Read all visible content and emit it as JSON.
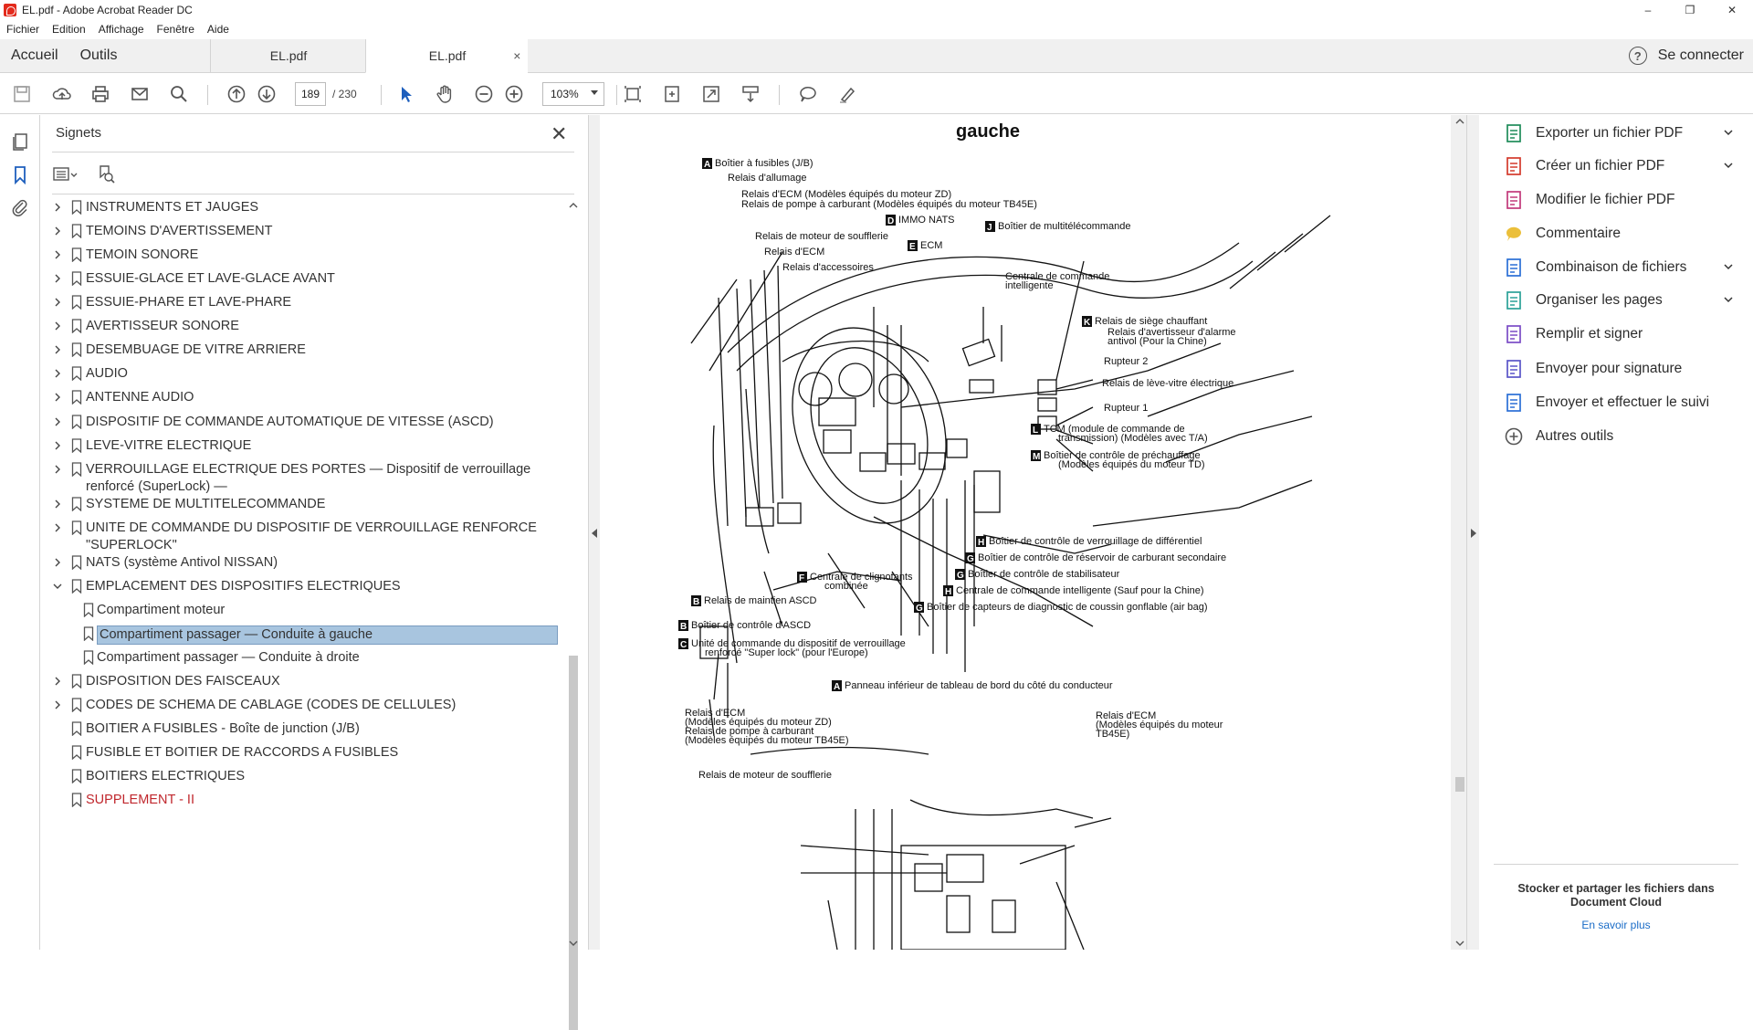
{
  "window": {
    "title": "EL.pdf - Adobe Acrobat Reader DC",
    "controls": [
      "–",
      "❐",
      "✕"
    ]
  },
  "menu": [
    "Fichier",
    "Edition",
    "Affichage",
    "Fenêtre",
    "Aide"
  ],
  "tabs": {
    "home": "Accueil",
    "tools": "Outils",
    "doc1": "EL.pdf",
    "doc2": "EL.pdf",
    "close": "×",
    "help": "?",
    "signin": "Se connecter"
  },
  "toolbar": {
    "page_current": "189",
    "page_total": "/ 230",
    "zoom": "103%"
  },
  "bookmarks": {
    "title": "Signets",
    "close": "✕",
    "items": [
      {
        "label": "INSTRUMENTS ET JAUGES",
        "level": 0,
        "expand": "collapsed"
      },
      {
        "label": "TEMOINS D'AVERTISSEMENT",
        "level": 0,
        "expand": "collapsed"
      },
      {
        "label": "TEMOIN SONORE",
        "level": 0,
        "expand": "collapsed"
      },
      {
        "label": "ESSUIE-GLACE ET LAVE-GLACE AVANT",
        "level": 0,
        "expand": "collapsed"
      },
      {
        "label": "ESSUIE-PHARE ET LAVE-PHARE",
        "level": 0,
        "expand": "collapsed"
      },
      {
        "label": "AVERTISSEUR SONORE",
        "level": 0,
        "expand": "collapsed"
      },
      {
        "label": "DESEMBUAGE DE VITRE ARRIERE",
        "level": 0,
        "expand": "collapsed"
      },
      {
        "label": "AUDIO",
        "level": 0,
        "expand": "collapsed"
      },
      {
        "label": "ANTENNE AUDIO",
        "level": 0,
        "expand": "collapsed"
      },
      {
        "label": "DISPOSITIF DE COMMANDE AUTOMATIQUE DE VITESSE (ASCD)",
        "level": 0,
        "expand": "collapsed"
      },
      {
        "label": "LEVE-VITRE ELECTRIQUE",
        "level": 0,
        "expand": "collapsed"
      },
      {
        "label": "VERROUILLAGE ELECTRIQUE DES PORTES — Dispositif de verrouillage",
        "label2": "renforcé (SuperLock) —",
        "level": 0,
        "expand": "collapsed"
      },
      {
        "label": "SYSTEME DE MULTITELECOMMANDE",
        "level": 0,
        "expand": "collapsed"
      },
      {
        "label": "UNITE DE COMMANDE DU DISPOSITIF DE VERROUILLAGE RENFORCE",
        "label2": "\"SUPERLOCK\"",
        "level": 0,
        "expand": "collapsed"
      },
      {
        "label": "NATS (système Antivol NISSAN)",
        "level": 0,
        "expand": "collapsed"
      },
      {
        "label": "EMPLACEMENT DES DISPOSITIFS ELECTRIQUES",
        "level": 0,
        "expand": "expanded"
      },
      {
        "label": "Compartiment moteur",
        "level": 1,
        "expand": "none"
      },
      {
        "label": "Compartiment passager — Conduite à gauche",
        "level": 1,
        "expand": "none",
        "selected": true
      },
      {
        "label": "Compartiment passager — Conduite à droite",
        "level": 1,
        "expand": "none"
      },
      {
        "label": "DISPOSITION DES FAISCEAUX",
        "level": 0,
        "expand": "collapsed"
      },
      {
        "label": "CODES DE SCHEMA DE CABLAGE (CODES DE CELLULES)",
        "level": 0,
        "expand": "collapsed"
      },
      {
        "label": "BOITIER A FUSIBLES - Boîte de junction (J/B)",
        "level": 0,
        "expand": "none"
      },
      {
        "label": "FUSIBLE ET BOITIER DE RACCORDS A FUSIBLES",
        "level": 0,
        "expand": "none"
      },
      {
        "label": "BOITIERS ELECTRIQUES",
        "level": 0,
        "expand": "none"
      },
      {
        "label": "SUPPLEMENT - II",
        "level": 0,
        "expand": "none",
        "red": true
      }
    ]
  },
  "page": {
    "heading": "gauche",
    "labels": [
      {
        "tag": "A",
        "text": "Boîtier à fusibles (J/B)"
      },
      {
        "tag": "",
        "text": "Relais d'allumage"
      },
      {
        "tag": "",
        "text": "Relais d'ECM (Modèles équipés du moteur ZD)"
      },
      {
        "tag": "",
        "text": "Relais de pompe à carburant (Modèles équipés du moteur TB45E)"
      },
      {
        "tag": "",
        "text": "Relais de moteur de soufflerie"
      },
      {
        "tag": "",
        "text": "Relais d'ECM"
      },
      {
        "tag": "",
        "text": "Relais d'accessoires"
      },
      {
        "tag": "D",
        "text": "IMMO NATS"
      },
      {
        "tag": "E",
        "text": "ECM"
      },
      {
        "tag": "J",
        "text": "Boîtier de multitélécommande"
      },
      {
        "tag": "",
        "text": "Centrale de commande"
      },
      {
        "tag": "",
        "text": "intelligente"
      },
      {
        "tag": "K",
        "text": "Relais de siège chauffant"
      },
      {
        "tag": "",
        "text": "Relais d'avertisseur d'alarme"
      },
      {
        "tag": "",
        "text": "antivol (Pour la Chine)"
      },
      {
        "tag": "",
        "text": "Rupteur 2"
      },
      {
        "tag": "",
        "text": "Relais de lève-vitre électrique"
      },
      {
        "tag": "",
        "text": "Rupteur 1"
      },
      {
        "tag": "L",
        "text": "TCM (module de commande de"
      },
      {
        "tag": "",
        "text": "transmission) (Modèles avec T/A)"
      },
      {
        "tag": "M",
        "text": "Boîtier de contrôle de préchauffage"
      },
      {
        "tag": "",
        "text": "(Modèles équipés du moteur TD)"
      },
      {
        "tag": "H",
        "text": "Boîtier de contrôle de verrouillage de différentiel"
      },
      {
        "tag": "G",
        "text": "Boîtier de contrôle de réservoir de carburant secondaire"
      },
      {
        "tag": "G",
        "text": "Boîtier de contrôle de stabilisateur"
      },
      {
        "tag": "H",
        "text": "Centrale de commande intelligente (Sauf pour la Chine)"
      },
      {
        "tag": "G",
        "text": "Boîtier de capteurs de diagnostic de coussin gonflable (air bag)"
      },
      {
        "tag": "F",
        "text": "Centrale de clignotants"
      },
      {
        "tag": "",
        "text": "combinée"
      },
      {
        "tag": "B",
        "text": "Relais de maintien ASCD"
      },
      {
        "tag": "B",
        "text": "Boîtier de contrôle d'ASCD"
      },
      {
        "tag": "C",
        "text": "Unité de commande du dispositif de verrouillage"
      },
      {
        "tag": "",
        "text": "renforcé \"Super lock\" (pour l'Europe)"
      },
      {
        "tag": "A",
        "text": "Panneau inférieur de tableau de bord du côté du conducteur"
      },
      {
        "tag": "",
        "text": "Relais d'ECM"
      },
      {
        "tag": "",
        "text": "(Modèles équipés du moteur ZD)"
      },
      {
        "tag": "",
        "text": "Relais de pompe à carburant"
      },
      {
        "tag": "",
        "text": "(Modèles équipés du moteur TB45E)"
      },
      {
        "tag": "",
        "text": "Relais de moteur de soufflerie"
      },
      {
        "tag": "",
        "text": "Relais d'ECM"
      },
      {
        "tag": "",
        "text": "(Modèles équipés du moteur"
      },
      {
        "tag": "",
        "text": "TB45E)"
      }
    ]
  },
  "right_panel": {
    "tools": [
      {
        "label": "Exporter un fichier PDF",
        "icon": "export-pdf-icon",
        "color": "#1e8c5a",
        "dropdown": true
      },
      {
        "label": "Créer un fichier PDF",
        "icon": "create-pdf-icon",
        "color": "#d33a2c",
        "dropdown": true
      },
      {
        "label": "Modifier le fichier PDF",
        "icon": "edit-pdf-icon",
        "color": "#c2397a",
        "dropdown": false
      },
      {
        "label": "Commentaire",
        "icon": "comment-icon",
        "color": "#e8b417",
        "dropdown": false
      },
      {
        "label": "Combinaison de fichiers",
        "icon": "combine-icon",
        "color": "#2a6fd6",
        "dropdown": true
      },
      {
        "label": "Organiser les pages",
        "icon": "organize-icon",
        "color": "#2aa198",
        "dropdown": true
      },
      {
        "label": "Remplir et signer",
        "icon": "fill-sign-icon",
        "color": "#7b4cc6",
        "dropdown": false
      },
      {
        "label": "Envoyer pour signature",
        "icon": "send-signature-icon",
        "color": "#5a54c8",
        "dropdown": false
      },
      {
        "label": "Envoyer et effectuer le suivi",
        "icon": "send-track-icon",
        "color": "#2a6fd6",
        "dropdown": false
      },
      {
        "label": "Autres outils",
        "icon": "more-tools-icon",
        "color": "#555555",
        "dropdown": false
      }
    ],
    "cloud_text": "Stocker et partager les fichiers dans Document Cloud",
    "cloud_link": "En savoir plus"
  }
}
